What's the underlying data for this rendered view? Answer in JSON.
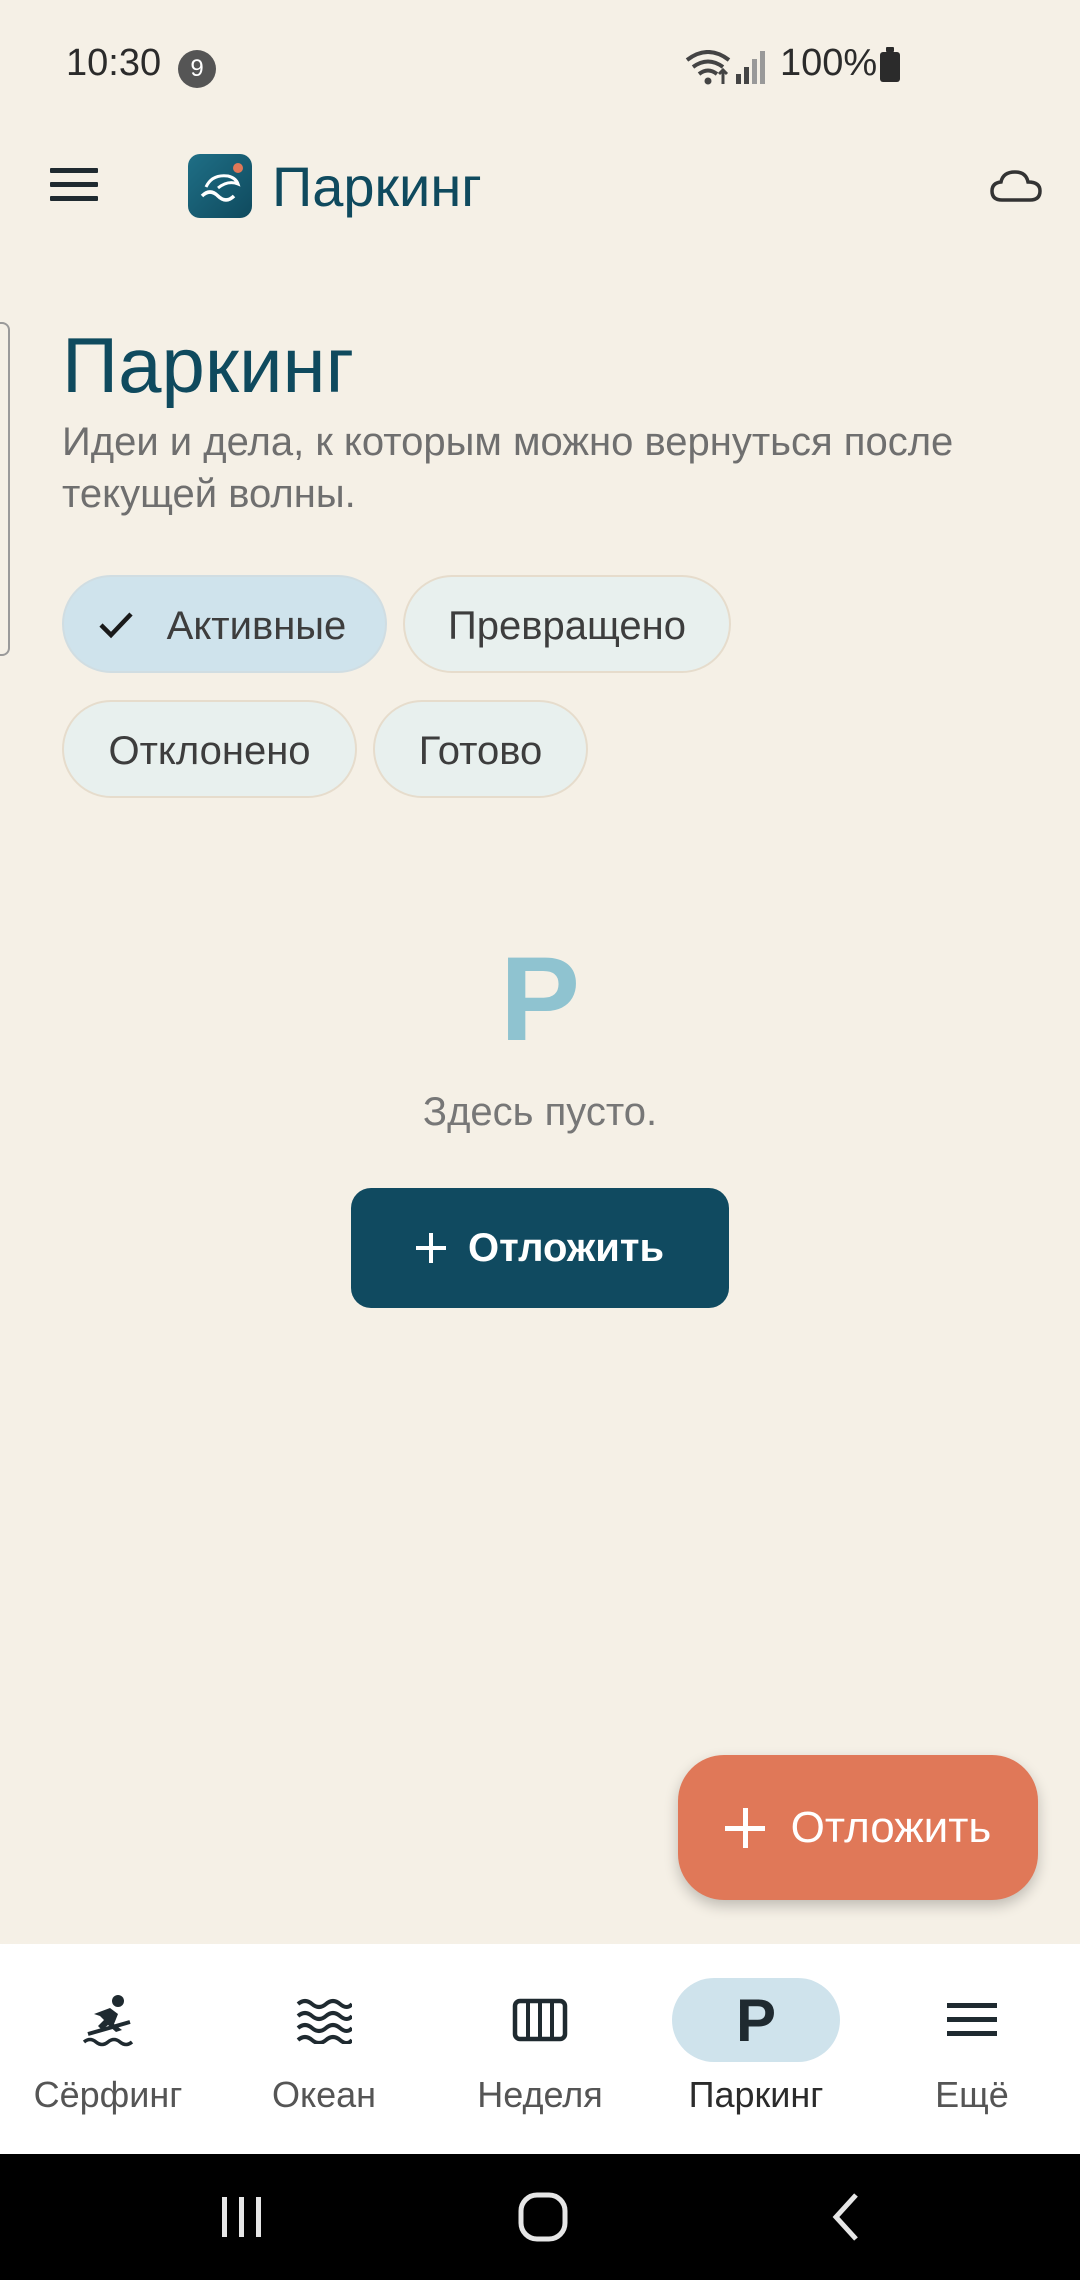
{
  "status_bar": {
    "time": "10:30",
    "notification_count": "9",
    "battery": "100%"
  },
  "app_bar": {
    "title": "Паркинг",
    "icons": [
      "menu-icon",
      "app-logo",
      "cloud-icon"
    ]
  },
  "header": {
    "title": "Паркинг",
    "subtitle": "Идеи и дела, к которым можно вернуться после текущей волны."
  },
  "filters": [
    {
      "label": "Активные",
      "selected": true
    },
    {
      "label": "Превращено",
      "selected": false
    },
    {
      "label": "Отклонено",
      "selected": false
    },
    {
      "label": "Готово",
      "selected": false
    }
  ],
  "empty_state": {
    "letter": "P",
    "text": "Здесь пусто.",
    "button_label": "Отложить"
  },
  "fab": {
    "label": "Отложить"
  },
  "bottom_nav": [
    {
      "label": "Сёрфинг",
      "icon": "surfer-icon",
      "active": false
    },
    {
      "label": "Океан",
      "icon": "waves-icon",
      "active": false
    },
    {
      "label": "Неделя",
      "icon": "week-columns-icon",
      "active": false
    },
    {
      "label": "Паркинг",
      "icon": "parking-icon",
      "active": true
    },
    {
      "label": "Ещё",
      "icon": "menu-icon",
      "active": false
    }
  ],
  "colors": {
    "background": "#f5f0e6",
    "primary": "#0f4a5e",
    "accent": "#e07858",
    "chip_selected": "#cfe3ec"
  }
}
